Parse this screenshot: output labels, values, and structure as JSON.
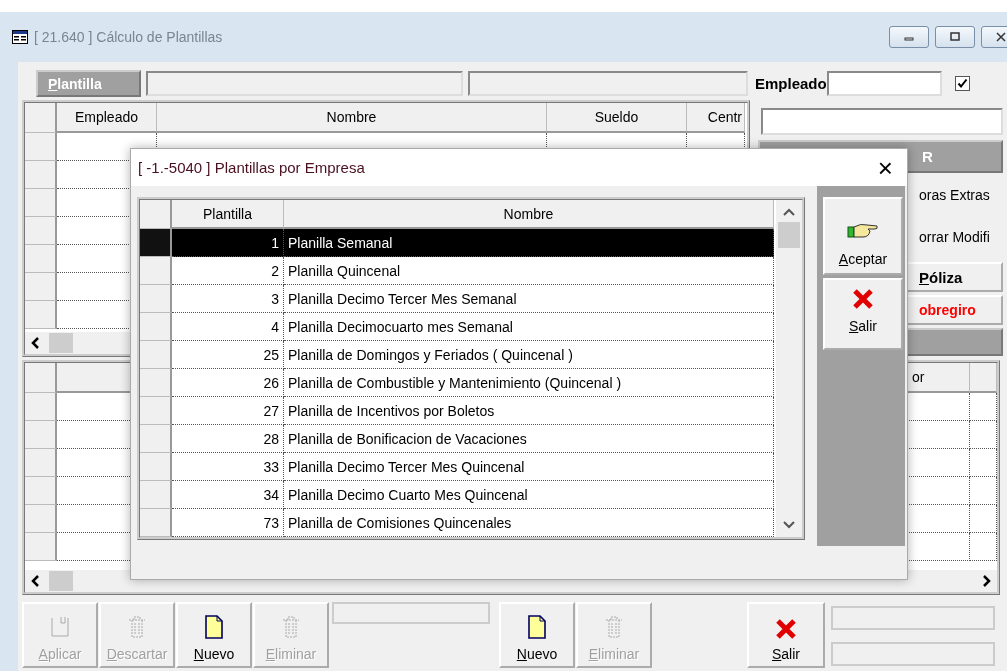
{
  "window": {
    "title": "[ 21.640 ] Cálculo de Plantillas"
  },
  "top_bar": {
    "tab": "Plantilla",
    "employee_label": "Empleado",
    "employee_checked": true
  },
  "upper_grid": {
    "columns": [
      "Empleado",
      "Nombre",
      "Sueldo",
      "Centr"
    ]
  },
  "right_panel": {
    "button_1": "R",
    "option_1": "oras Extras",
    "option_2": "orrar Modifi",
    "poliza_button": "Póliza",
    "sobregiro_button": "obregiro"
  },
  "lower_grid": {
    "columns": [
      "or"
    ]
  },
  "toolbar": [
    {
      "label": "Aplicar",
      "kind": "save",
      "disabled": true
    },
    {
      "label": "Descartar",
      "kind": "trash",
      "disabled": true
    },
    {
      "label": "Nuevo",
      "kind": "new",
      "disabled": false
    },
    {
      "label": "Eliminar",
      "kind": "delete",
      "disabled": true
    }
  ],
  "toolbar_2": [
    {
      "label": "Nuevo",
      "kind": "new",
      "disabled": false
    },
    {
      "label": "Eliminar",
      "kind": "delete",
      "disabled": true
    }
  ],
  "exit_button": {
    "label": "Salir",
    "kind": "exit"
  },
  "dialog": {
    "title": "[ -1.-5040 ] Plantillas por Empresa",
    "close": "×",
    "columns": [
      "Plantilla",
      "Nombre"
    ],
    "rows": [
      {
        "id": "1",
        "name": "Planilla Semanal",
        "selected": true
      },
      {
        "id": "2",
        "name": "Planilla Quincenal",
        "selected": false
      },
      {
        "id": "3",
        "name": "Planilla Decimo Tercer Mes Semanal",
        "selected": false
      },
      {
        "id": "4",
        "name": "Planilla Decimocuarto mes Semanal",
        "selected": false
      },
      {
        "id": "25",
        "name": "Planilla de Domingos y Feriados ( Quincenal )",
        "selected": false
      },
      {
        "id": "26",
        "name": "Planilla de Combustible y Mantenimiento (Quincenal )",
        "selected": false
      },
      {
        "id": "27",
        "name": "Planilla de Incentivos por Boletos",
        "selected": false
      },
      {
        "id": "28",
        "name": "Planilla de Bonificacion de Vacaciones",
        "selected": false
      },
      {
        "id": "33",
        "name": "Planilla Decimo Tercer Mes Quincenal",
        "selected": false
      },
      {
        "id": "34",
        "name": "Planilla Decimo Cuarto Mes Quincenal",
        "selected": false
      },
      {
        "id": "73",
        "name": "Planilla de Comisiones Quincenales",
        "selected": false
      }
    ],
    "buttons": [
      {
        "label": "Aceptar",
        "kind": "accept"
      },
      {
        "label": "Salir",
        "kind": "exit"
      }
    ]
  }
}
